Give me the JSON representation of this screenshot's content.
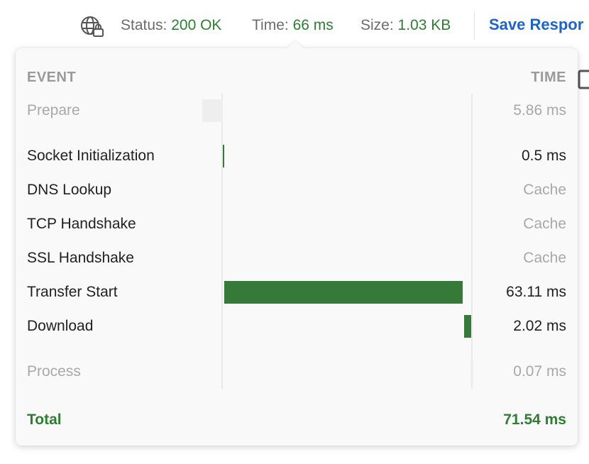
{
  "header": {
    "status_label": "Status:",
    "status_value": "200 OK",
    "time_label": "Time:",
    "time_value": "66 ms",
    "size_label": "Size:",
    "size_value": "1.03 KB",
    "save_label": "Save Respor",
    "network_icon": "globe-lock-icon",
    "copy_icon": "copy-icon"
  },
  "popover": {
    "col_event": "EVENT",
    "col_time": "TIME",
    "events": [
      {
        "label": "Prepare",
        "time": "5.86 ms",
        "bar_fraction": 0.082,
        "start_fraction": -0.082,
        "muted": true
      },
      {
        "label": "Socket Initialization",
        "time": "0.5 ms",
        "bar_fraction": 0.007,
        "start_fraction": 0.0
      },
      {
        "label": "DNS Lookup",
        "time": "Cache",
        "bar_fraction": 0,
        "start_fraction": 0.007
      },
      {
        "label": "TCP Handshake",
        "time": "Cache",
        "bar_fraction": 0,
        "start_fraction": 0.007
      },
      {
        "label": "SSL Handshake",
        "time": "Cache",
        "bar_fraction": 0,
        "start_fraction": 0.007
      },
      {
        "label": "Transfer Start",
        "time": "63.11 ms",
        "bar_fraction": 0.96,
        "start_fraction": 0.007
      },
      {
        "label": "Download",
        "time": "2.02 ms",
        "bar_fraction": 0.03,
        "start_fraction": 0.97
      },
      {
        "label": "Process",
        "time": "0.07 ms",
        "bar_fraction": 0.01,
        "start_fraction": 0.998,
        "muted": true
      }
    ],
    "total_label": "Total",
    "total_value": "71.54 ms"
  },
  "colors": {
    "accent_green": "#2e7d32",
    "bar_green": "#357a38",
    "link_blue": "#1d64c8"
  }
}
